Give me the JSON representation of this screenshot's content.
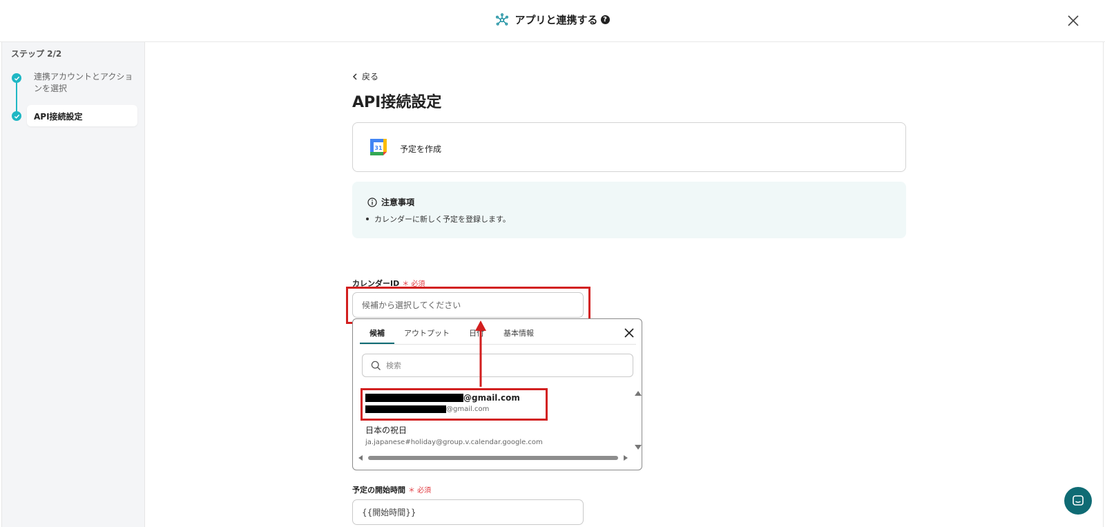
{
  "header": {
    "title": "アプリと連携する",
    "help": "?"
  },
  "sidebar": {
    "step_label": "ステップ 2/2",
    "steps": [
      {
        "label": "連携アカウントとアクションを選択",
        "state": "done"
      },
      {
        "label": "API接続設定",
        "state": "current"
      }
    ],
    "accent_color": "#1fb7c4"
  },
  "main": {
    "back_label": "戻る",
    "title": "API接続設定",
    "action": {
      "label": "予定を作成",
      "icon": "google-calendar-icon"
    },
    "notice": {
      "title": "注意事項",
      "items": [
        "カレンダーに新しく予定を登録します。"
      ]
    },
    "fields": [
      {
        "label": "カレンダーID",
        "required": "＊ 必須",
        "placeholder": "候補から選択してください"
      },
      {
        "label": "予定の開始時間",
        "required": "＊ 必須",
        "value": "{{開始時間}}"
      }
    ]
  },
  "dropdown": {
    "tabs": [
      "候補",
      "アウトプット",
      "日付",
      "基本情報"
    ],
    "active_tab": "候補",
    "search_placeholder": "検索",
    "options": [
      {
        "title_suffix": "@gmail.com",
        "sub_suffix": "@gmail.com",
        "redacted": true
      },
      {
        "title": "日本の祝日",
        "sub": "ja.japanese#holiday@group.v.calendar.google.com"
      }
    ]
  },
  "colors": {
    "highlight": "#d21f1f",
    "teal": "#0f6b74",
    "required": "#e0383e"
  }
}
